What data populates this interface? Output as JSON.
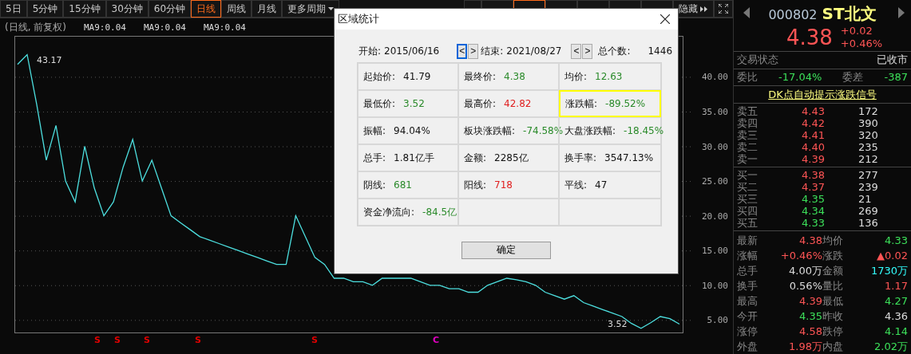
{
  "toolbar": {
    "periods": [
      {
        "label": "5日",
        "selected": false,
        "kind": "plain"
      },
      {
        "label": "5分钟",
        "selected": false,
        "kind": "plain"
      },
      {
        "label": "15分钟",
        "selected": false,
        "kind": "plain"
      },
      {
        "label": "30分钟",
        "selected": false,
        "kind": "plain"
      },
      {
        "label": "60分钟",
        "selected": false,
        "kind": "plain"
      },
      {
        "label": "日线",
        "selected": true,
        "kind": "plain"
      },
      {
        "label": "周线",
        "selected": false,
        "kind": "plain"
      },
      {
        "label": "月线",
        "selected": false,
        "kind": "plain"
      },
      {
        "label": "更多周期",
        "selected": false,
        "kind": "dropdown"
      }
    ],
    "tools": [
      {
        "selected": false,
        "kind": "plain"
      },
      {
        "selected": false,
        "kind": "plain"
      },
      {
        "selected": true,
        "kind": "plain"
      },
      {
        "selected": false,
        "kind": "plain"
      },
      {
        "selected": false,
        "kind": "plain"
      },
      {
        "selected": false,
        "kind": "plain"
      },
      {
        "selected": false,
        "kind": "plain"
      },
      {
        "label": "隐藏",
        "selected": false,
        "kind": "more"
      }
    ]
  },
  "indicator_line": {
    "mode": "(日线, 前复权)",
    "ma": [
      "MA9:0.04",
      "MA9:0.04",
      "MA9:0.04"
    ]
  },
  "chart": {
    "chart_data": {
      "type": "line",
      "grid": true,
      "ylim": [
        3.2,
        45.9
      ],
      "yticks": [
        {
          "value": 5,
          "label": "5.00"
        },
        {
          "value": 10,
          "label": "10.00"
        },
        {
          "value": 15,
          "label": "15.00"
        },
        {
          "value": 20,
          "label": "20.00"
        },
        {
          "value": 25,
          "label": "25.00"
        },
        {
          "value": 30,
          "label": "30.00"
        },
        {
          "value": 35,
          "label": "35.00"
        },
        {
          "value": 40,
          "label": "40.00"
        }
      ],
      "series": [
        {
          "color": "#4de0e0",
          "values": [
            41.8,
            43.2,
            36,
            28,
            33,
            25,
            22,
            30,
            24,
            20,
            22,
            27,
            31,
            25,
            28,
            24,
            20,
            19,
            18,
            17,
            16.5,
            16,
            15.5,
            15,
            14.5,
            14,
            13.5,
            13,
            13,
            20,
            17,
            14,
            13,
            11,
            11,
            10.5,
            10.5,
            10,
            11,
            11,
            11,
            11,
            10.5,
            10,
            10,
            9.5,
            9.5,
            9,
            9,
            10,
            10.5,
            11,
            10.8,
            10.5,
            10,
            9,
            8.5,
            8,
            8.5,
            7.5,
            7,
            6.5,
            6,
            5.5,
            4.5,
            3.8,
            4.6,
            5.5,
            5.2,
            4.4
          ]
        }
      ],
      "annotations": [
        "43.17",
        "3.52"
      ]
    }
  },
  "signals": [
    {
      "label": "S",
      "color": "#e00000"
    },
    {
      "label": "S",
      "color": "#e00000"
    },
    {
      "label": "S",
      "color": "#e00000"
    },
    {
      "label": "S",
      "color": "#e00000"
    },
    {
      "label": "S",
      "color": "#e00000"
    },
    {
      "label": "C",
      "color": "#e000c0"
    }
  ],
  "dialog": {
    "title": "区域统计",
    "range": {
      "start_label": "开始:",
      "start": "2015/06/16",
      "end_label": "结束:",
      "end": "2021/08/27",
      "count_label": "总个数:",
      "count": "1446",
      "start_arrows": [
        {
          "label": "<",
          "selected": true
        },
        {
          "label": ">",
          "selected": false
        }
      ],
      "end_arrows": [
        {
          "label": "<",
          "selected": false
        },
        {
          "label": ">",
          "selected": false
        }
      ]
    },
    "rows": [
      [
        {
          "label": "起始价:",
          "value": "41.79",
          "color": "#111111",
          "highlighted": false
        },
        {
          "label": "最终价:",
          "value": "4.38",
          "color": "#2a8a2a",
          "highlighted": false
        },
        {
          "label": "均价:",
          "value": "12.63",
          "color": "#2a8a2a",
          "highlighted": false
        }
      ],
      [
        {
          "label": "最低价:",
          "value": "3.52",
          "color": "#2a8a2a",
          "highlighted": false
        },
        {
          "label": "最高价:",
          "value": "42.82",
          "color": "#e02020",
          "highlighted": false
        },
        {
          "label": "涨跌幅:",
          "value": "-89.52%",
          "color": "#2a8a2a",
          "highlighted": true
        }
      ],
      [
        {
          "label": "振幅:",
          "value": "94.04%",
          "color": "#111111",
          "highlighted": false
        },
        {
          "label": "板块涨跌幅:",
          "value": "-74.58%",
          "color": "#2a8a2a",
          "highlighted": false
        },
        {
          "label": "大盘涨跌幅:",
          "value": "-18.45%",
          "color": "#2a8a2a",
          "highlighted": false
        }
      ],
      [
        {
          "label": "总手:",
          "value": "1.81亿手",
          "color": "#111111",
          "highlighted": false
        },
        {
          "label": "金额:",
          "value": "2285亿",
          "color": "#111111",
          "highlighted": false
        },
        {
          "label": "换手率:",
          "value": "3547.13%",
          "color": "#111111",
          "highlighted": false
        }
      ],
      [
        {
          "label": "阴线:",
          "value": "681",
          "color": "#2a8a2a",
          "highlighted": false
        },
        {
          "label": "阳线:",
          "value": "718",
          "color": "#e02020",
          "highlighted": false
        },
        {
          "label": "平线:",
          "value": "47",
          "color": "#111111",
          "highlighted": false
        }
      ],
      [
        {
          "label": "资金净流向:",
          "value": "-84.5亿",
          "color": "#2a8a2a",
          "highlighted": false
        }
      ]
    ],
    "ok_button": "确定"
  },
  "quote": {
    "code": "000802",
    "name": "ST北文",
    "price": "4.38",
    "change": "+0.02",
    "change_pct": "+0.46%",
    "status_label": "交易状态",
    "status": "已收市",
    "ratio_label": "委比",
    "ratio": "-17.04%",
    "diff_label": "委差",
    "diff": "-387",
    "signal_link": "DK点自动提示涨跌信号",
    "asks": [
      {
        "label": "卖五",
        "price": "4.43",
        "volume": "172",
        "color": "#ff5555"
      },
      {
        "label": "卖四",
        "price": "4.42",
        "volume": "390",
        "color": "#ff5555"
      },
      {
        "label": "卖三",
        "price": "4.41",
        "volume": "320",
        "color": "#ff5555"
      },
      {
        "label": "卖二",
        "price": "4.40",
        "volume": "235",
        "color": "#ff5555"
      },
      {
        "label": "卖一",
        "price": "4.39",
        "volume": "212",
        "color": "#ff5555"
      }
    ],
    "bids": [
      {
        "label": "买一",
        "price": "4.38",
        "volume": "277",
        "color": "#ff5555"
      },
      {
        "label": "买二",
        "price": "4.37",
        "volume": "239",
        "color": "#ff5555"
      },
      {
        "label": "买三",
        "price": "4.35",
        "volume": "21",
        "color": "#3ce05a"
      },
      {
        "label": "买四",
        "price": "4.34",
        "volume": "269",
        "color": "#3ce05a"
      },
      {
        "label": "买五",
        "price": "4.33",
        "volume": "136",
        "color": "#3ce05a"
      }
    ],
    "stats": [
      [
        {
          "label": "最新",
          "value": "4.38",
          "color": "#ff5555"
        },
        {
          "label": "均价",
          "value": "4.33",
          "color": "#3ce05a"
        }
      ],
      [
        {
          "label": "涨幅",
          "value": "+0.46%",
          "color": "#ff5555"
        },
        {
          "label": "涨跌",
          "value": "▲0.02",
          "color": "#ff5555"
        }
      ],
      [
        {
          "label": "总手",
          "value": "4.00万",
          "color": "#dddddd"
        },
        {
          "label": "金额",
          "value": "1730万",
          "color": "#33ffff"
        }
      ],
      [
        {
          "label": "换手",
          "value": "0.56%",
          "color": "#dddddd"
        },
        {
          "label": "量比",
          "value": "1.17",
          "color": "#ff5555"
        }
      ],
      [
        {
          "label": "最高",
          "value": "4.39",
          "color": "#ff5555"
        },
        {
          "label": "最低",
          "value": "4.27",
          "color": "#3ce05a"
        }
      ],
      [
        {
          "label": "今开",
          "value": "4.35",
          "color": "#3ce05a"
        },
        {
          "label": "昨收",
          "value": "4.36",
          "color": "#dddddd"
        }
      ],
      [
        {
          "label": "涨停",
          "value": "4.58",
          "color": "#ff5555"
        },
        {
          "label": "跌停",
          "value": "4.14",
          "color": "#3ce05a"
        }
      ],
      [
        {
          "label": "外盘",
          "value": "1.98万",
          "color": "#ff5555"
        },
        {
          "label": "内盘",
          "value": "2.02万",
          "color": "#3ce05a"
        }
      ]
    ]
  }
}
